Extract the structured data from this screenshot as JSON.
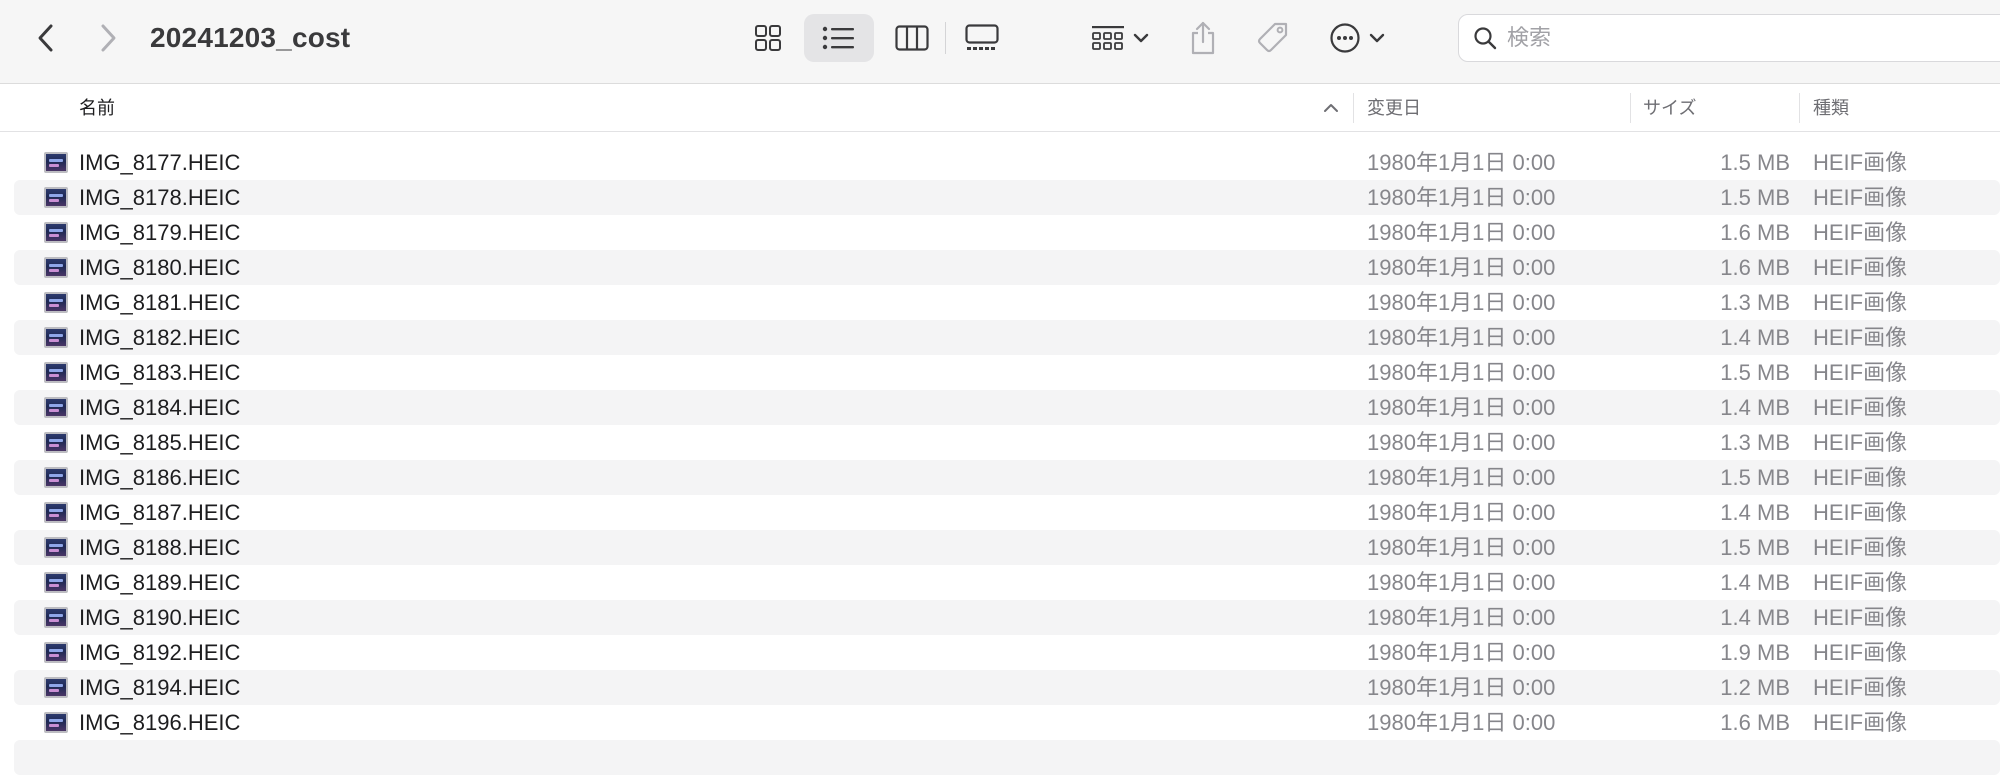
{
  "window": {
    "title": "20241203_cost"
  },
  "toolbar": {
    "back_icon": "chevron-left-icon",
    "forward_icon": "chevron-right-icon",
    "views": [
      "icon-view-icon",
      "list-view-icon",
      "column-view-icon",
      "gallery-view-icon"
    ],
    "selected_view": "list",
    "group_icon": "group-by-icon",
    "share_icon": "share-icon",
    "tag_icon": "tag-icon",
    "more_icon": "ellipsis-circle-icon"
  },
  "search": {
    "placeholder": "検索",
    "value": ""
  },
  "columns": {
    "name": "名前",
    "date": "変更日",
    "size": "サイズ",
    "kind": "種類",
    "sorted_by": "name",
    "sort_direction": "ascending"
  },
  "files": [
    {
      "name": "IMG_8177.HEIC",
      "date": "1980年1月1日 0:00",
      "size": "1.5 MB",
      "kind": "HEIF画像"
    },
    {
      "name": "IMG_8178.HEIC",
      "date": "1980年1月1日 0:00",
      "size": "1.5 MB",
      "kind": "HEIF画像"
    },
    {
      "name": "IMG_8179.HEIC",
      "date": "1980年1月1日 0:00",
      "size": "1.6 MB",
      "kind": "HEIF画像"
    },
    {
      "name": "IMG_8180.HEIC",
      "date": "1980年1月1日 0:00",
      "size": "1.6 MB",
      "kind": "HEIF画像"
    },
    {
      "name": "IMG_8181.HEIC",
      "date": "1980年1月1日 0:00",
      "size": "1.3 MB",
      "kind": "HEIF画像"
    },
    {
      "name": "IMG_8182.HEIC",
      "date": "1980年1月1日 0:00",
      "size": "1.4 MB",
      "kind": "HEIF画像"
    },
    {
      "name": "IMG_8183.HEIC",
      "date": "1980年1月1日 0:00",
      "size": "1.5 MB",
      "kind": "HEIF画像"
    },
    {
      "name": "IMG_8184.HEIC",
      "date": "1980年1月1日 0:00",
      "size": "1.4 MB",
      "kind": "HEIF画像"
    },
    {
      "name": "IMG_8185.HEIC",
      "date": "1980年1月1日 0:00",
      "size": "1.3 MB",
      "kind": "HEIF画像"
    },
    {
      "name": "IMG_8186.HEIC",
      "date": "1980年1月1日 0:00",
      "size": "1.5 MB",
      "kind": "HEIF画像"
    },
    {
      "name": "IMG_8187.HEIC",
      "date": "1980年1月1日 0:00",
      "size": "1.4 MB",
      "kind": "HEIF画像"
    },
    {
      "name": "IMG_8188.HEIC",
      "date": "1980年1月1日 0:00",
      "size": "1.5 MB",
      "kind": "HEIF画像"
    },
    {
      "name": "IMG_8189.HEIC",
      "date": "1980年1月1日 0:00",
      "size": "1.4 MB",
      "kind": "HEIF画像"
    },
    {
      "name": "IMG_8190.HEIC",
      "date": "1980年1月1日 0:00",
      "size": "1.4 MB",
      "kind": "HEIF画像"
    },
    {
      "name": "IMG_8192.HEIC",
      "date": "1980年1月1日 0:00",
      "size": "1.9 MB",
      "kind": "HEIF画像"
    },
    {
      "name": "IMG_8194.HEIC",
      "date": "1980年1月1日 0:00",
      "size": "1.2 MB",
      "kind": "HEIF画像"
    },
    {
      "name": "IMG_8196.HEIC",
      "date": "1980年1月1日 0:00",
      "size": "1.6 MB",
      "kind": "HEIF画像"
    }
  ]
}
